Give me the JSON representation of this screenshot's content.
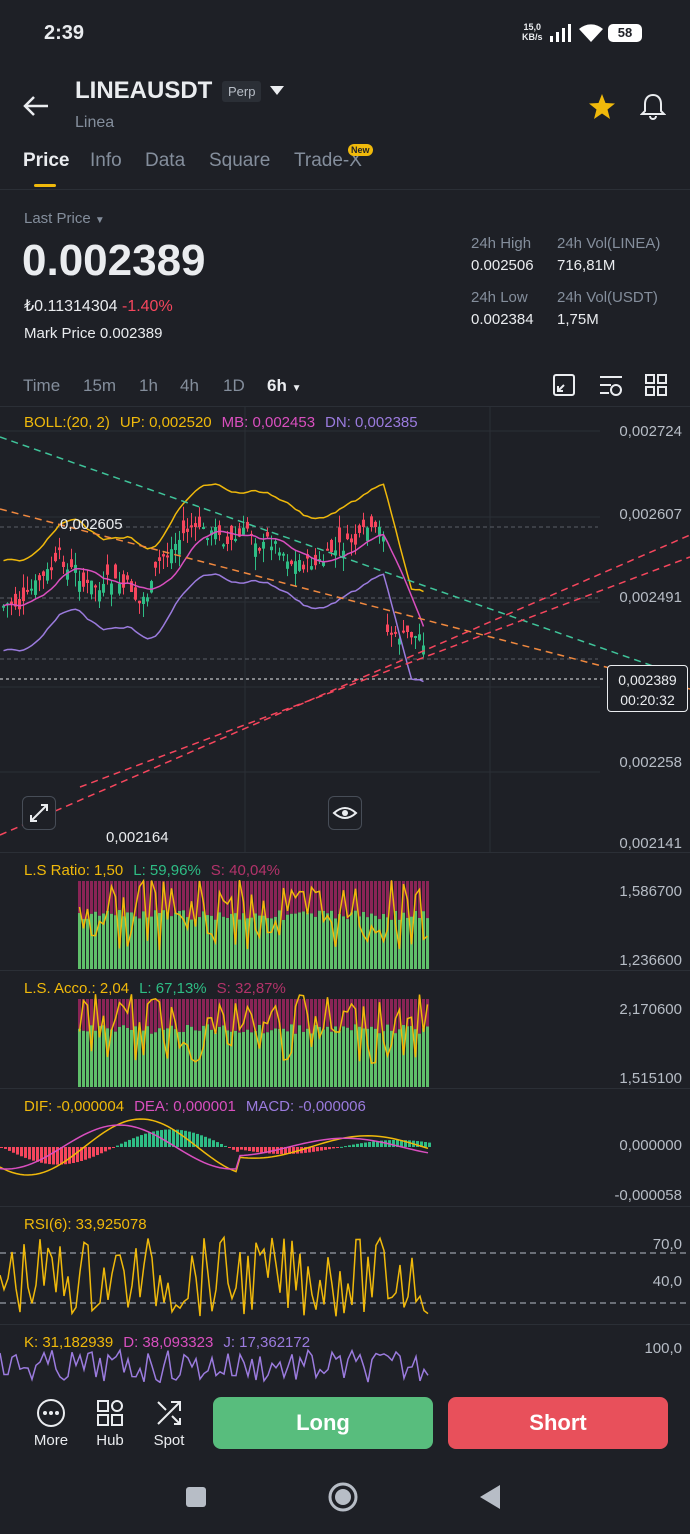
{
  "status_bar": {
    "time": "2:39",
    "net_speed_value": "15,0",
    "net_speed_unit": "KB/s",
    "battery": "58"
  },
  "header": {
    "symbol": "LINEAUSDT",
    "contract_type": "Perp",
    "name": "Linea"
  },
  "tabs": [
    {
      "label": "Price"
    },
    {
      "label": "Info"
    },
    {
      "label": "Data"
    },
    {
      "label": "Square"
    },
    {
      "label": "Trade-X"
    }
  ],
  "tab_new_badge": "New",
  "price": {
    "last_price_label": "Last Price",
    "last_price": "0.002389",
    "local_price": "₺0.11314304",
    "change": "-1.40%",
    "mark_price_label": "Mark Price",
    "mark_price": "0.002389"
  },
  "stats": {
    "high_label": "24h High",
    "high": "0.002506",
    "vol_base_label": "24h Vol(LINEA)",
    "vol_base": "716,81M",
    "low_label": "24h Low",
    "low": "0.002384",
    "vol_quote_label": "24h Vol(USDT)",
    "vol_quote": "1,75M"
  },
  "timeframes": [
    "Time",
    "15m",
    "1h",
    "4h",
    "1D",
    "6h"
  ],
  "boll": {
    "label": "BOLL:(20, 2)",
    "up": "UP: 0,002520",
    "mb": "MB: 0,002453",
    "dn": "DN: 0,002385"
  },
  "price_axis": [
    "0,002724",
    "0,002607",
    "0,002491",
    "0,002258",
    "0,002141"
  ],
  "current_price_box": {
    "price": "0,002389",
    "countdown": "00:20:32"
  },
  "chart_annotations": {
    "high": "0,002605",
    "low": "0,002164"
  },
  "ls_ratio": {
    "label": "L.S Ratio: 1,50",
    "long": "L: 59,96%",
    "short": "S: 40,04%",
    "axis": [
      "1,586700",
      "1,236600"
    ]
  },
  "ls_acco": {
    "label": "L.S. Acco.: 2,04",
    "long": "L: 67,13%",
    "short": "S: 32,87%",
    "axis": [
      "2,170600",
      "1,515100"
    ]
  },
  "macd": {
    "dif": "DIF: -0,000004",
    "dea": "DEA: 0,000001",
    "macd": "MACD: -0,000006",
    "axis": [
      "0,000000",
      "-0,000058"
    ]
  },
  "rsi": {
    "label": "RSI(6): 33,925078",
    "axis": [
      "70,0",
      "40,0"
    ]
  },
  "kdj": {
    "k": "K: 31,182939",
    "d": "D: 38,093323",
    "j": "J: 17,362172",
    "axis": [
      "100,0"
    ]
  },
  "bottom_nav": {
    "more": "More",
    "hub": "Hub",
    "spot": "Spot",
    "long": "Long",
    "short": "Short"
  },
  "colors": {
    "bg": "#1e2026",
    "up": "#2ebd85",
    "down": "#f6465d",
    "accent": "#f0b90b",
    "long_btn": "#58bd7d",
    "short_btn": "#e8505b"
  }
}
